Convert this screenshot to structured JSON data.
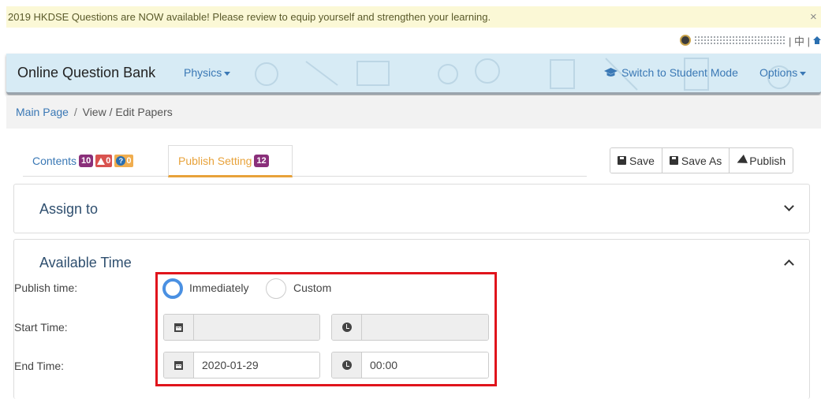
{
  "announcement": {
    "text": "2019 HKDSE Questions are NOW available! Please review to equip yourself and strengthen your learning.",
    "close": "×"
  },
  "userbar": {
    "lang": "| 中 |",
    "icons": [
      "avatar",
      "home-icon"
    ]
  },
  "navbar": {
    "brand": "Online Question Bank",
    "subject": "Physics",
    "switch_mode": "Switch to Student Mode",
    "options": "Options"
  },
  "breadcrumb": {
    "home": "Main Page",
    "separator": "/",
    "current": "View / Edit Papers"
  },
  "tabs": [
    {
      "label": "Contents",
      "badge": "10",
      "warn_count": "0",
      "question_count": "0"
    },
    {
      "label": "Publish Setting",
      "badge": "12",
      "active": true
    }
  ],
  "actions": {
    "save": "Save",
    "save_as": "Save As",
    "publish": "Publish"
  },
  "assign": {
    "title": "Assign to"
  },
  "available_time": {
    "title": "Available Time",
    "publish_time_label": "Publish time:",
    "options": [
      "Immediately",
      "Custom"
    ],
    "selected": "Immediately",
    "start_label": "Start Time:",
    "start_date": "",
    "start_time": "",
    "end_label": "End Time:",
    "end_date": "2020-01-29",
    "end_time": "00:00"
  },
  "colors": {
    "accent": "#3a78b5",
    "active_tab": "#e8a23a",
    "badge": "#8a2f7a",
    "highlight": "#e0141c",
    "radio_selected": "#4a90e2"
  }
}
